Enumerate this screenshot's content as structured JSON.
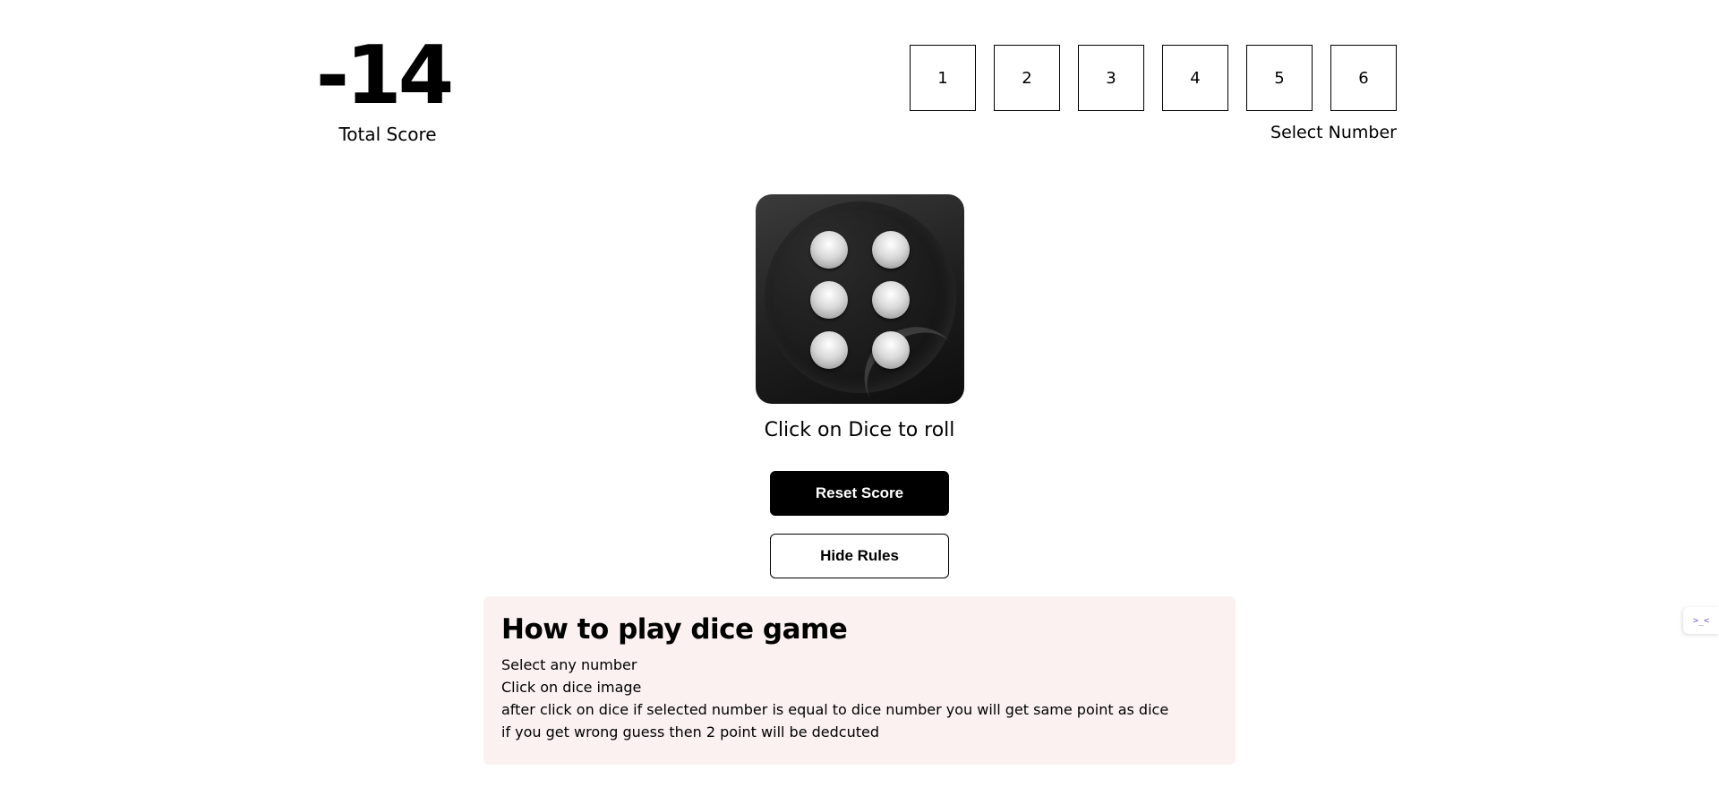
{
  "score": {
    "value": "-14",
    "label": "Total Score"
  },
  "number_select": {
    "numbers": [
      "1",
      "2",
      "3",
      "4",
      "5",
      "6"
    ],
    "label": "Select Number"
  },
  "dice": {
    "current_value": 6,
    "hint": "Click on Dice to roll"
  },
  "buttons": {
    "reset_label": "Reset Score",
    "rules_label": "Hide Rules"
  },
  "rules": {
    "title": "How to play dice game",
    "lines": [
      "Select any number",
      "Click on dice image",
      "after click on dice if selected number is equal to dice number you will get same point as dice",
      "if you get wrong guess then 2 point will be dedcuted"
    ]
  },
  "side_widget": {
    "icon": "terminal-icon",
    "glyph": ">_<"
  },
  "colors": {
    "primary": "#000000",
    "background": "#ffffff",
    "rules_background": "#fbf1f1"
  }
}
